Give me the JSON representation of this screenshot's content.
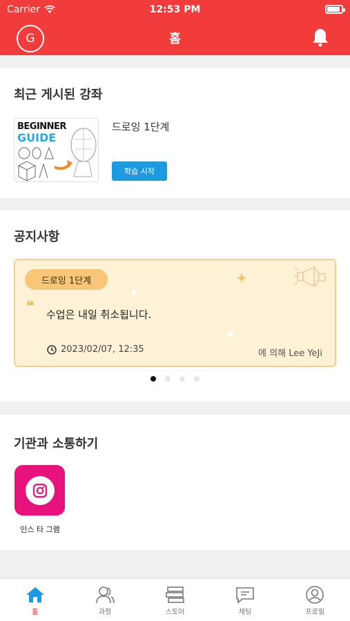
{
  "status_bar": {
    "carrier": "Carrier",
    "time": "12:53 PM"
  },
  "nav": {
    "avatar_letter": "G",
    "title": "홈"
  },
  "recent": {
    "title": "최근 게시된 강좌",
    "thumbnail_line1": "BEGINNER",
    "thumbnail_line2": "GUIDE",
    "course_name": "드로잉 1단계",
    "start_button": "학습 시작"
  },
  "notices": {
    "title": "공지사항",
    "tag": "드로잉 1단계",
    "quote_mark": "❝",
    "text": "수업은 내일 취소됩니다.",
    "datetime": "2023/02/07, 12:35",
    "author": "에 의해 Lee YeJi",
    "page_count": 4,
    "active_page": 1
  },
  "communicate": {
    "title": "기관과 소통하기",
    "instagram_label": "인스 타 그램"
  },
  "colors": {
    "brand_red": "#f23b3b",
    "accent_blue": "#1e9be0",
    "instagram": "#e8127c"
  },
  "tabs": [
    {
      "label": "홈",
      "icon": "home-icon",
      "active": true
    },
    {
      "label": "과정",
      "icon": "users-icon",
      "active": false
    },
    {
      "label": "스토어",
      "icon": "books-icon",
      "active": false
    },
    {
      "label": "채팅",
      "icon": "chat-icon",
      "active": false
    },
    {
      "label": "프로필",
      "icon": "profile-icon",
      "active": false
    }
  ]
}
